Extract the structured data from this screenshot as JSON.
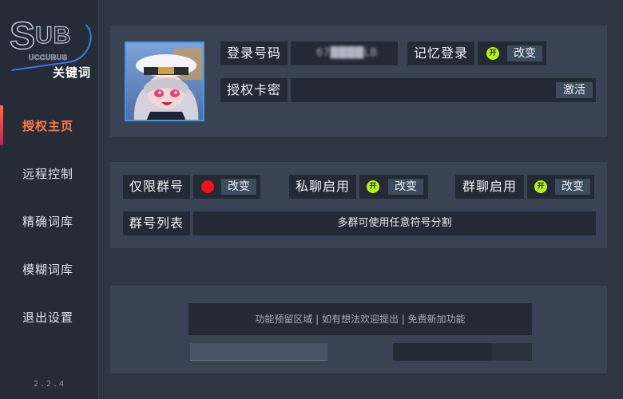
{
  "sidebar": {
    "logo": {
      "letters_s": "S",
      "letters_ub": "UB",
      "subtitle": "UCCUBUS",
      "keyword_label": "关键词"
    },
    "items": [
      {
        "label": "授权主页",
        "active": true
      },
      {
        "label": "远程控制",
        "active": false
      },
      {
        "label": "精确词库",
        "active": false
      },
      {
        "label": "模糊词库",
        "active": false
      },
      {
        "label": "退出设置",
        "active": false
      }
    ],
    "version": "2.2.4"
  },
  "login": {
    "account_label": "登录号码",
    "account_value_blurred": "67████LB",
    "remember_label": "记忆登录",
    "remember_toggle": "开",
    "remember_change": "改变",
    "auth_label": "授权卡密",
    "auth_value": "",
    "activate_button": "激活"
  },
  "group": {
    "limit_label": "仅限群号",
    "limit_change": "改变",
    "limit_status_color": "#f2101f",
    "private_label": "私聊启用",
    "private_toggle": "开",
    "private_change": "改变",
    "group_chat_label": "群聊启用",
    "group_chat_toggle": "开",
    "group_chat_change": "改变",
    "list_label": "群号列表",
    "list_placeholder": "多群可使用任意符号分割"
  },
  "reserved": {
    "hint": "功能预留区域 | 如有想法欢迎提出 | 免费新加功能"
  },
  "colors": {
    "accent_active": "#ff7a45",
    "toggle_on": "#b6f21a",
    "status_off": "#f2101f",
    "panel": "#3a4353",
    "field": "#232a35"
  }
}
